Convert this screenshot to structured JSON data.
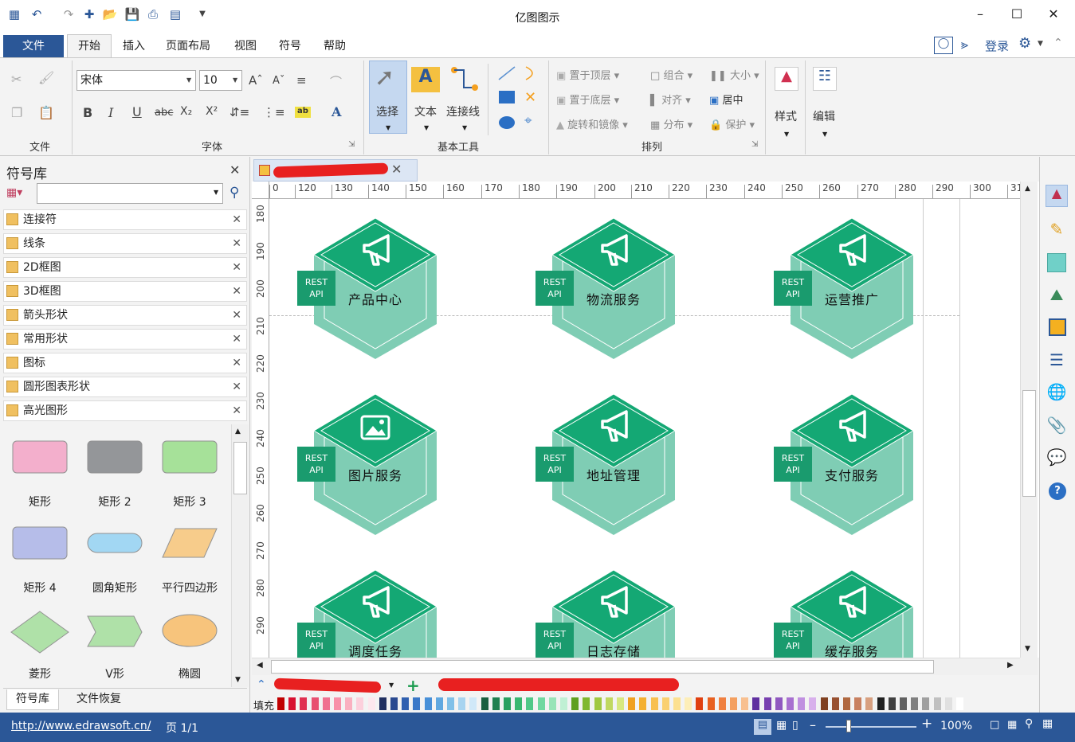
{
  "app": {
    "title": "亿图图示"
  },
  "menu": {
    "tabs": [
      "文件",
      "开始",
      "插入",
      "页面布局",
      "视图",
      "符号",
      "帮助"
    ],
    "login": "登录"
  },
  "ribbon": {
    "groups": {
      "file": "文件",
      "font": "字体",
      "basic_tools": "基本工具",
      "arrange": "排列"
    },
    "font_name": "宋体",
    "font_size": "10",
    "basic": {
      "select": "选择",
      "text": "文本",
      "connector": "连接线"
    },
    "arrange": {
      "bring_front": "置于顶层",
      "send_back": "置于底层",
      "rotate_mirror": "旋转和镜像",
      "group": "组合",
      "align": "对齐",
      "distribute": "分布",
      "size": "大小",
      "center": "居中",
      "protect": "保护"
    },
    "style": "样式",
    "edit": "编辑"
  },
  "library": {
    "title": "符号库",
    "items": [
      "连接符",
      "线条",
      "2D框图",
      "3D框图",
      "箭头形状",
      "常用形状",
      "图标",
      "圆形图表形状",
      "高光图形"
    ],
    "shapes": [
      {
        "label": "矩形",
        "color": "#f4a8c8"
      },
      {
        "label": "矩形 2",
        "color": "#8a8c90"
      },
      {
        "label": "矩形 3",
        "color": "#9ee090"
      },
      {
        "label": "矩形 4",
        "color": "#b0b8e8"
      },
      {
        "label": "圆角矩形",
        "color": "#9ad4f4"
      },
      {
        "label": "平行四边形",
        "color": "#f8c880"
      },
      {
        "label": "菱形",
        "color": "#a8e0a0"
      },
      {
        "label": "V形",
        "color": "#a8e0a0"
      },
      {
        "label": "椭圆",
        "color": "#f8c070"
      }
    ],
    "bottom_tabs": [
      "符号库",
      "文件恢复"
    ]
  },
  "ruler": {
    "h": [
      "0",
      "120",
      "130",
      "140",
      "150",
      "160",
      "170",
      "180",
      "190",
      "200",
      "210",
      "220",
      "230",
      "240",
      "250",
      "260",
      "270",
      "280",
      "290",
      "300",
      "31"
    ],
    "v": [
      "180",
      "190",
      "200",
      "210",
      "220",
      "230",
      "240",
      "250",
      "260",
      "270",
      "280",
      "290"
    ]
  },
  "diagram": {
    "badge_line1": "REST",
    "badge_line2": "API",
    "nodes": [
      {
        "label": "产品中心",
        "icon": "megaphone-icon"
      },
      {
        "label": "物流服务",
        "icon": "megaphone-icon"
      },
      {
        "label": "运营推广",
        "icon": "megaphone-icon"
      },
      {
        "label": "图片服务",
        "icon": "image-icon"
      },
      {
        "label": "地址管理",
        "icon": "megaphone-icon"
      },
      {
        "label": "支付服务",
        "icon": "megaphone-icon"
      },
      {
        "label": "调度任务",
        "icon": "megaphone-icon"
      },
      {
        "label": "日志存储",
        "icon": "megaphone-icon"
      },
      {
        "label": "缓存服务",
        "icon": "megaphone-icon"
      }
    ],
    "colors": {
      "top": "#14a874",
      "side": "#7fcdb4",
      "badge": "#1a9b6e"
    }
  },
  "bottom": {
    "fill_label": "填充"
  },
  "status": {
    "url": "http://www.edrawsoft.cn/",
    "page": "页 1/1",
    "zoom": "100%"
  }
}
